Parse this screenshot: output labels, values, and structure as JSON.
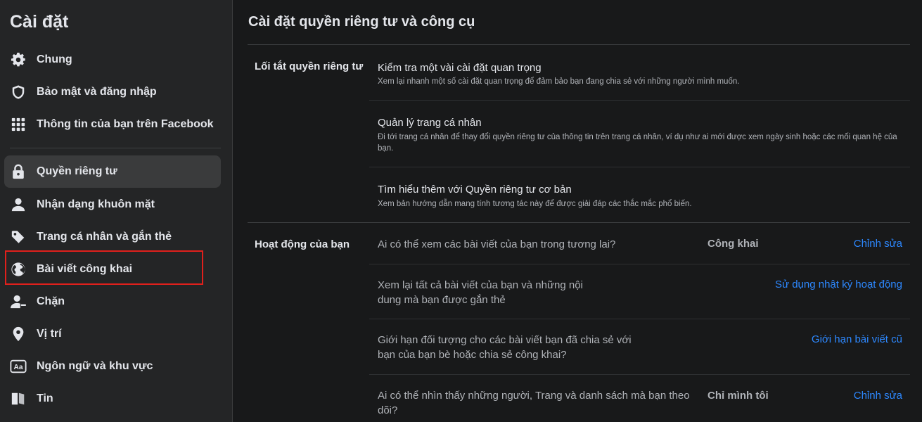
{
  "sidebar": {
    "title": "Cài đặt",
    "items": [
      {
        "label": "Chung",
        "icon": "gear-icon"
      },
      {
        "label": "Bảo mật và đăng nhập",
        "icon": "shield-icon"
      },
      {
        "label": "Thông tin của bạn trên Facebook",
        "icon": "grid-icon"
      },
      {
        "label": "Quyền riêng tư",
        "icon": "lock-icon",
        "active": true
      },
      {
        "label": "Nhận dạng khuôn mặt",
        "icon": "face-person-icon"
      },
      {
        "label": "Trang cá nhân và gắn thẻ",
        "icon": "tag-icon"
      },
      {
        "label": "Bài viết công khai",
        "icon": "globe-icon"
      },
      {
        "label": "Chặn",
        "icon": "block-user-icon"
      },
      {
        "label": "Vị trí",
        "icon": "location-pin-icon"
      },
      {
        "label": "Ngôn ngữ và khu vực",
        "icon": "language-icon"
      },
      {
        "label": "Tin",
        "icon": "book-icon"
      }
    ]
  },
  "main": {
    "title": "Cài đặt quyền riêng tư và công cụ",
    "shortcuts": {
      "label": "Lối tắt quyền riêng tư",
      "items": [
        {
          "title": "Kiểm tra một vài cài đặt quan trọng",
          "desc": "Xem lại nhanh một số cài đặt quan trọng để đảm bảo bạn đang chia sẻ với những người mình muốn."
        },
        {
          "title": "Quản lý trang cá nhân",
          "desc": "Đi tới trang cá nhân để thay đổi quyền riêng tư của thông tin trên trang cá nhân, ví dụ như ai mới được xem ngày sinh hoặc các mối quan hệ của bạn."
        },
        {
          "title": "Tìm hiểu thêm với Quyền riêng tư cơ bản",
          "desc": "Xem bản hướng dẫn mang tính tương tác này để được giải đáp các thắc mắc phổ biến."
        }
      ]
    },
    "activity": {
      "label": "Hoạt động của bạn",
      "rows": [
        {
          "question": "Ai có thể xem các bài viết của bạn trong tương lai?",
          "value": "Công khai",
          "action": "Chỉnh sửa"
        },
        {
          "question": "Xem lại tất cả bài viết của bạn và những nội dung mà bạn được gắn thẻ",
          "value": "",
          "action": "Sử dụng nhật ký hoạt động"
        },
        {
          "question": "Giới hạn đối tượng cho các bài viết bạn đã chia sẻ với bạn của bạn bè hoặc chia sẻ công khai?",
          "value": "",
          "action": "Giới hạn bài viết cũ"
        },
        {
          "question": "Ai có thể nhìn thấy những người, Trang và danh sách mà bạn theo dõi?",
          "value": "Chỉ mình tôi",
          "action": "Chỉnh sửa"
        }
      ]
    }
  },
  "colors": {
    "accent": "#2d88ff",
    "highlight": "#e0201c"
  }
}
